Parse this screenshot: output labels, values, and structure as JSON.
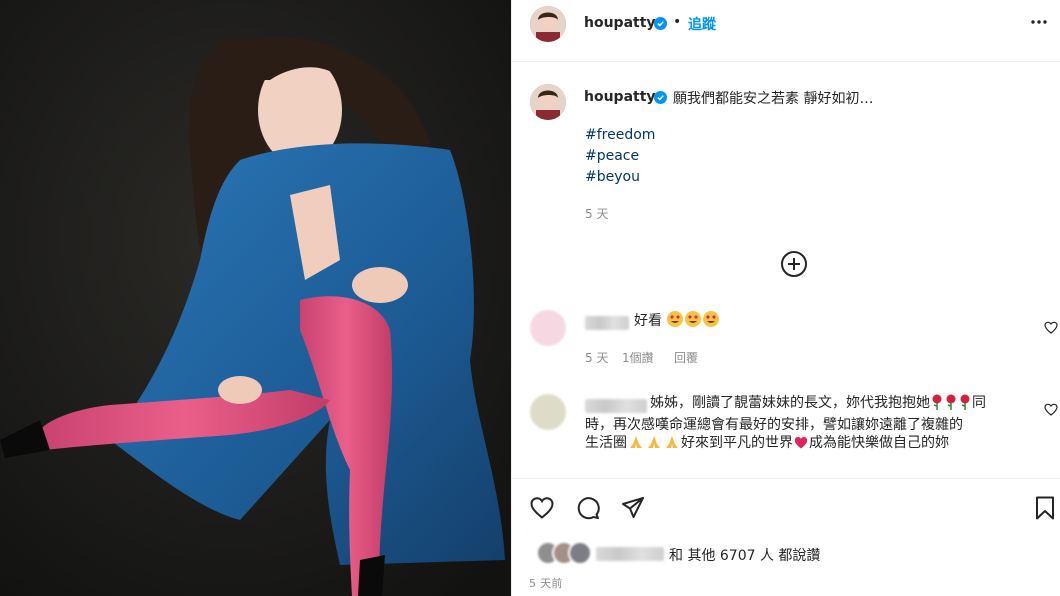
{
  "post": {
    "username": "houpatty",
    "follow_label": "追蹤",
    "separator": "•"
  },
  "caption": {
    "text": "願我們都能安之若素 靜好如初…",
    "hashtags": [
      "#freedom",
      "#peace",
      "#beyou"
    ],
    "time": "5 天"
  },
  "comments": [
    {
      "text": "好看",
      "time": "5 天",
      "likes": "1個讚",
      "reply_label": "回覆"
    },
    {
      "line1_a": "姊姊，剛讀了靚蕾妹妹的長文，妳代我抱抱她",
      "line1_b": "同",
      "line2": "時，再次感嘆命運總會有最好的安排，譬如讓妳遠離了複雜的",
      "line3_a": "生活圈",
      "line3_b": "好來到平凡的世界",
      "line3_c": "成為能快樂做自己的妳"
    }
  ],
  "likes": {
    "and_others": "和 其他 6707 人 都說讚"
  },
  "footer_time": "5 天前",
  "colors": {
    "link": "#0095f6",
    "hashtag": "#00376b",
    "meta": "#8e8e8e",
    "coat": "#1e5f9a",
    "tights": "#e0527e"
  },
  "icons": [
    "verified-badge-icon",
    "more-options-icon",
    "add-circle-icon",
    "heart-icon",
    "comment-icon",
    "share-icon",
    "bookmark-icon"
  ]
}
